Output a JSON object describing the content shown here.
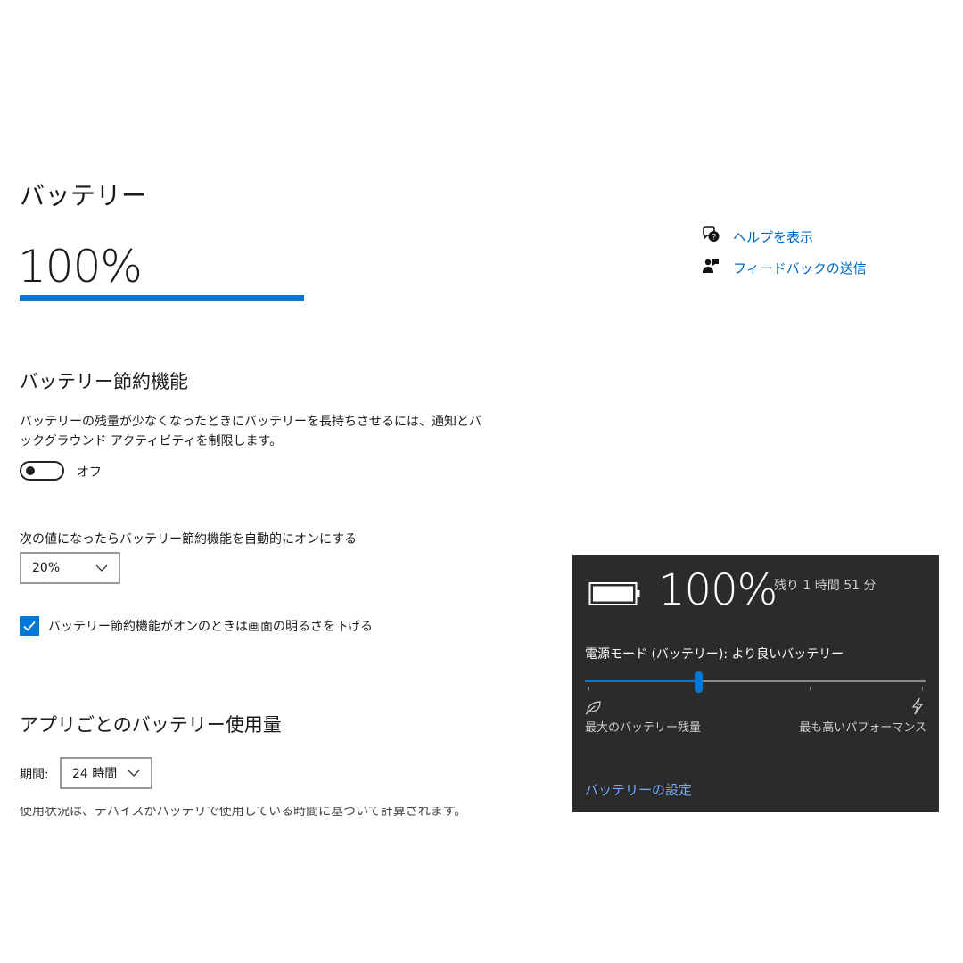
{
  "page": {
    "title": "バッテリー"
  },
  "battery": {
    "percent_label": "100%",
    "level": 1.0
  },
  "help": {
    "show_help": "ヘルプを表示",
    "send_feedback": "フィードバックの送信"
  },
  "saver": {
    "title": "バッテリー節約機能",
    "description": "バッテリーの残量が少なくなったときにバッテリーを長持ちさせるには、通知とバックグラウンド アクティビティを制限します。",
    "toggle_state": "オフ",
    "auto_on_label": "次の値になったらバッテリー節約機能を自動的にオンにする",
    "threshold_value": "20%",
    "lower_brightness_label": "バッテリー節約機能がオンのときは画面の明るさを下げる",
    "lower_brightness_checked": true
  },
  "usage": {
    "title": "アプリごとのバッテリー使用量",
    "period_label": "期間:",
    "period_value": "24 時間",
    "partial_text": "使用状況は、デバイスがバッテリで使用している時間に基づいて計算されます。"
  },
  "flyout": {
    "percent": "100%",
    "remaining": "残り 1 時間 51 分",
    "mode_label": "電源モード (バッテリー): より良いバッテリー",
    "slider_position": 0.335,
    "left_label": "最大のバッテリー残量",
    "right_label": "最も高いパフォーマンス",
    "settings_link": "バッテリーの設定"
  },
  "colors": {
    "accent": "#0078d7",
    "link": "#0067c0",
    "flyout_bg": "#2b2b2b"
  }
}
